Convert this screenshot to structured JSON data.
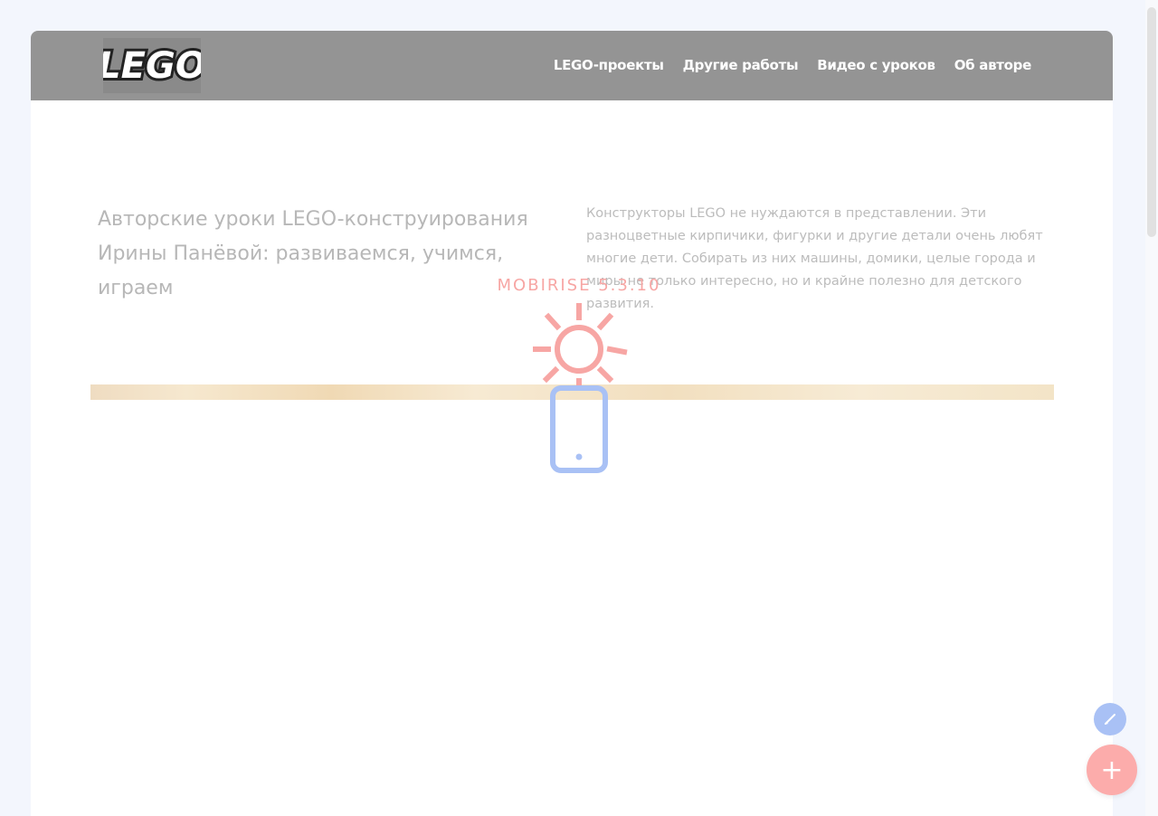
{
  "navbar": {
    "logo_text": "LEGO",
    "links": [
      "LEGO-проекты",
      "Другие работы",
      "Видео с уроков",
      "Об авторе"
    ]
  },
  "hero": {
    "title": "Авторские уроки LEGO-конструирования Ирины Панёвой: развиваемся, учимся, играем",
    "text": "Конструкторы LEGO не нуждаются в представлении. Эти разноцветные кирпичики, фигурки и другие детали очень любят многие дети. Собирать из них машины, домики, целые города и миры не только интересно, но и крайне полезно для детского развития."
  },
  "overlay": {
    "label": "MOBIRISE 5.3.10",
    "icons": [
      "sun-icon",
      "mobile-phone-icon"
    ]
  },
  "fabs": {
    "edit_icon": "brush-icon",
    "add_label": "+"
  },
  "colors": {
    "navbar": "#949494",
    "overlay_red": "#f7a6a4",
    "overlay_blue": "#a9c1f5",
    "fab_add": "#fcacab"
  }
}
